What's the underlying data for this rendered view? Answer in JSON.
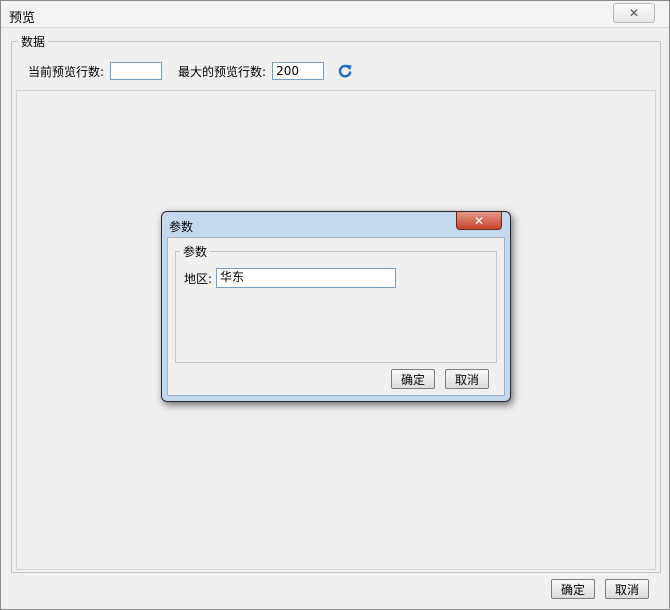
{
  "window": {
    "title": "预览",
    "close_symbol": "✕"
  },
  "data_group": {
    "label": "数据",
    "current_rows_label": "当前预览行数:",
    "current_rows_value": "",
    "max_rows_label": "最大的预览行数:",
    "max_rows_value": "200",
    "refresh_icon": "refresh-icon"
  },
  "footer": {
    "ok_label": "确定",
    "cancel_label": "取消"
  },
  "param_dialog": {
    "title": "参数",
    "close_symbol": "✕",
    "group_label": "参数",
    "region_label": "地区:",
    "region_value": "华东",
    "ok_label": "确定",
    "cancel_label": "取消"
  },
  "colors": {
    "dialog_frame": "#c5d9ee",
    "close_red": "#c8432a",
    "refresh_blue": "#1e6fc1"
  }
}
